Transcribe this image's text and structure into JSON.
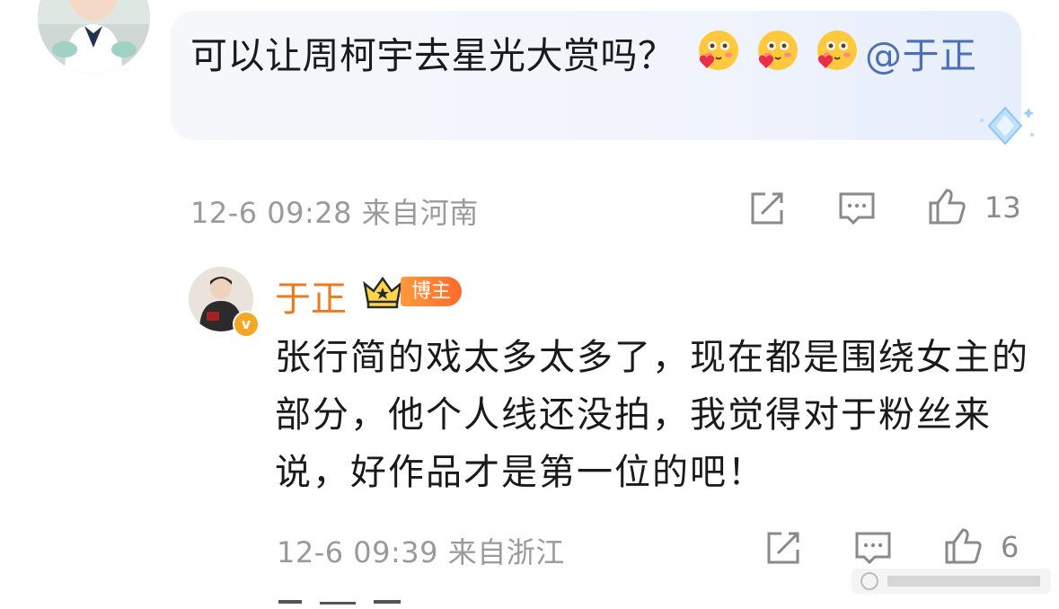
{
  "comment": {
    "text": "可以让周柯宇去星光大赏吗？",
    "emoji_name": "heart-blush-emoji",
    "mention": "@于正",
    "time": "12-6 09:28",
    "location": "来自河南",
    "likes": "13"
  },
  "reply": {
    "username": "于正",
    "badge": "博主",
    "verified_mark": "v",
    "text": "张行简的戏太多太多了，现在都是围绕女主的部分，他个人线还没拍，我觉得对于粉丝来说，好作品才是第一位的吧！",
    "time": "12-6 09:39",
    "location": "来自浙江",
    "likes": "6"
  },
  "icons": {
    "share": "share-icon",
    "comment": "comment-icon",
    "like": "like-icon"
  },
  "colors": {
    "username": "#ee7a1f",
    "mention": "#4c6fb8",
    "meta": "#9a9a9a",
    "badge": "#ff7a2a"
  }
}
